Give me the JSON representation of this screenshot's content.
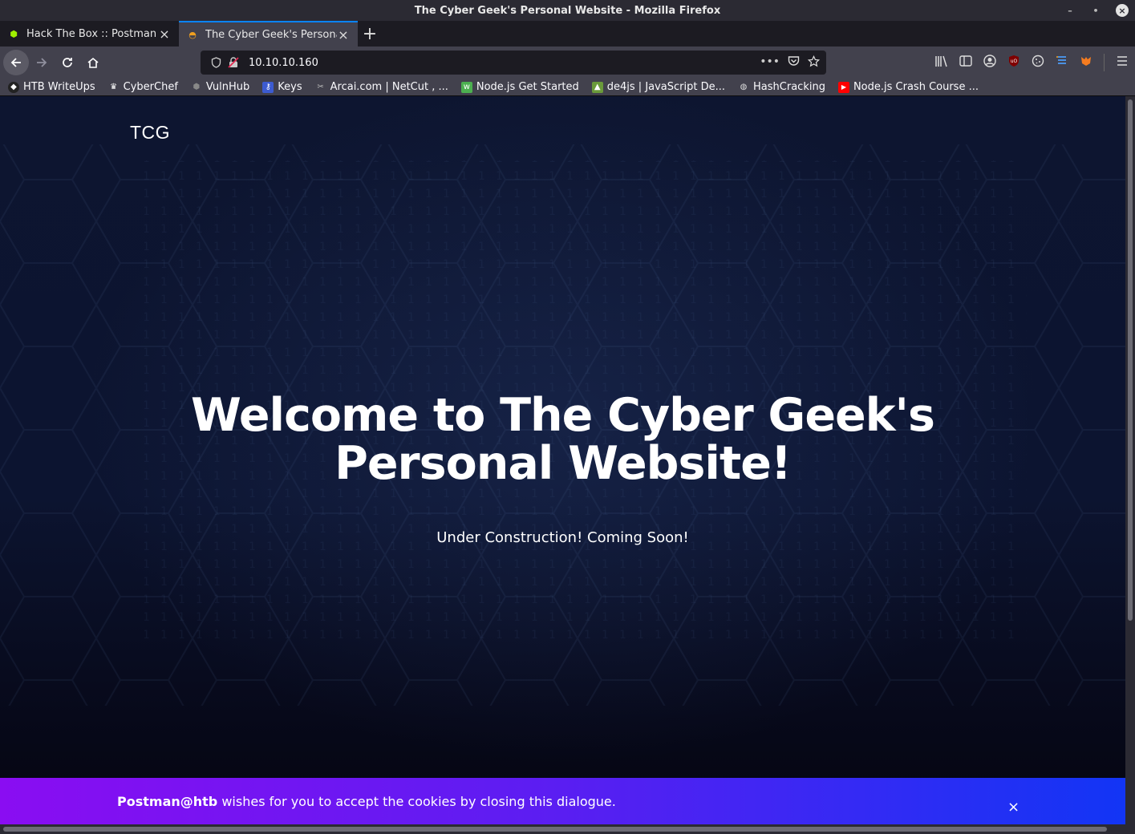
{
  "window": {
    "title": "The Cyber Geek's Personal Website - Mozilla Firefox",
    "controls": {
      "minimize": "–",
      "maximize": "•",
      "close": "×"
    }
  },
  "tabs": [
    {
      "title": "Hack The Box :: Postman",
      "icon": "hackthebox-icon",
      "active": false
    },
    {
      "title": "The Cyber Geek's Personal",
      "icon": "cybergeek-icon",
      "active": true
    }
  ],
  "new_tab_label": "+",
  "navbar": {
    "url": "10.10.10.160",
    "more_icon": "•••"
  },
  "bookmarks": [
    {
      "label": "HTB WriteUps",
      "icon": "htb-icon",
      "color": "#333333"
    },
    {
      "label": "CyberChef",
      "icon": "chef-icon",
      "color": "#dddddd"
    },
    {
      "label": "VulnHub",
      "icon": "vulnhub-icon",
      "color": "#555555"
    },
    {
      "label": "Keys",
      "icon": "keys-icon",
      "color": "#3c5bd0"
    },
    {
      "label": "Arcai.com | NetCut , ...",
      "icon": "netcut-icon",
      "color": "#42414d"
    },
    {
      "label": "Node.js Get Started",
      "icon": "w3-icon",
      "color": "#4caf50"
    },
    {
      "label": "de4js | JavaScript De...",
      "icon": "de4js-icon",
      "color": "#6a9a3a"
    },
    {
      "label": "HashCracking",
      "icon": "globe-icon",
      "color": "#42414d"
    },
    {
      "label": "Node.js Crash Course ...",
      "icon": "youtube-icon",
      "color": "#ff0000"
    }
  ],
  "page": {
    "logo": "TCG",
    "hero_title_line1": "Welcome to The Cyber Geek's",
    "hero_title_line2": "Personal Website!",
    "hero_subtitle": "Under Construction! Coming Soon!",
    "cookie": {
      "bold": "Postman@htb",
      "text": " wishes for you to accept the cookies by closing this dialogue.",
      "close": "×"
    }
  },
  "colors": {
    "accent": "#0a84ff",
    "cookie_start": "#8a0df2",
    "cookie_end": "#1235f5"
  }
}
